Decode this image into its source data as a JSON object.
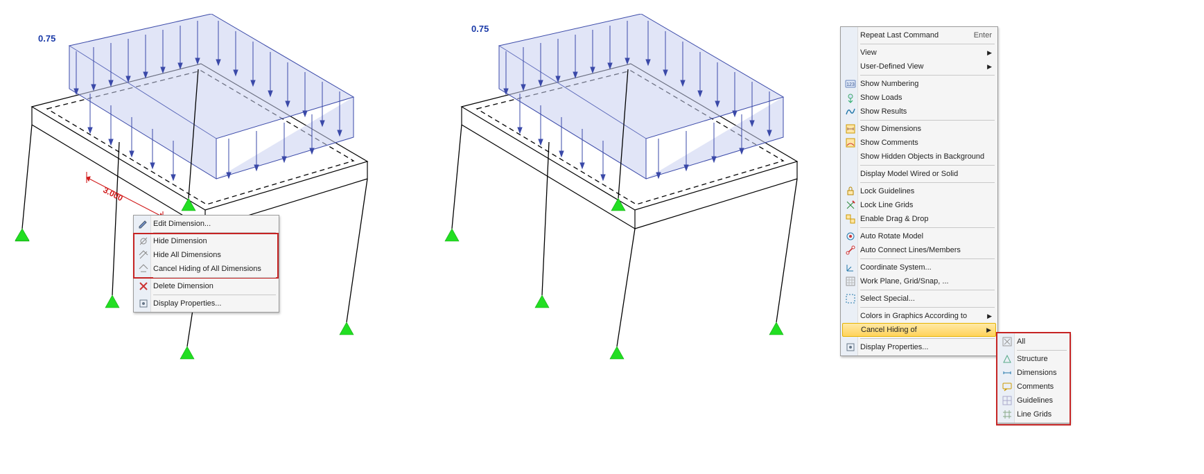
{
  "left_view": {
    "load_value": "0.75",
    "dimension_value": "3.000"
  },
  "right_view": {
    "load_value": "0.75"
  },
  "dimension_menu": {
    "edit": "Edit Dimension...",
    "hide": "Hide Dimension",
    "hide_all": "Hide All Dimensions",
    "cancel_hiding": "Cancel Hiding of All Dimensions",
    "delete": "Delete Dimension",
    "display_props": "Display Properties..."
  },
  "main_menu": {
    "repeat": "Repeat Last Command",
    "repeat_shortcut": "Enter",
    "view": "View",
    "user_defined_view": "User-Defined View",
    "show_numbering": "Show Numbering",
    "show_loads": "Show Loads",
    "show_results": "Show Results",
    "show_dimensions": "Show Dimensions",
    "show_comments": "Show Comments",
    "show_hidden_bg": "Show Hidden Objects in Background",
    "display_wired_solid": "Display Model Wired or Solid",
    "lock_guidelines": "Lock Guidelines",
    "lock_line_grids": "Lock Line Grids",
    "enable_drag_drop": "Enable Drag & Drop",
    "auto_rotate": "Auto Rotate Model",
    "auto_connect": "Auto Connect Lines/Members",
    "coord_system": "Coordinate System...",
    "work_plane": "Work Plane, Grid/Snap, ...",
    "select_special": "Select Special...",
    "colors_in_graphics": "Colors in Graphics According to",
    "cancel_hiding_of": "Cancel Hiding of",
    "display_props": "Display Properties..."
  },
  "submenu": {
    "all": "All",
    "structure": "Structure",
    "dimensions": "Dimensions",
    "comments": "Comments",
    "guidelines": "Guidelines",
    "line_grids": "Line Grids"
  }
}
